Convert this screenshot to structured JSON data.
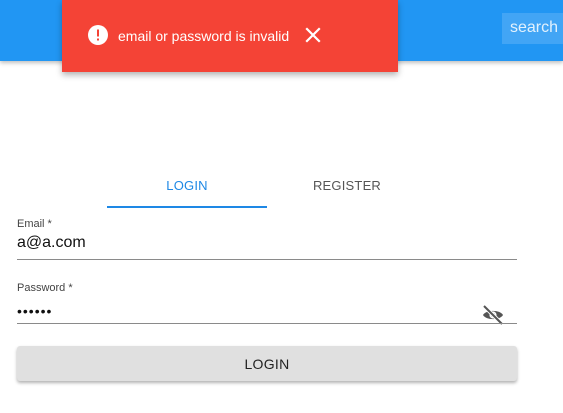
{
  "app_bar": {
    "color": "#2196f3",
    "search": {
      "placeholder": "search"
    }
  },
  "snackbar": {
    "color": "#f44336",
    "icon": "error-icon",
    "message": "email or password is invalid",
    "close_icon": "close-icon"
  },
  "tabs": [
    {
      "label": "LOGIN",
      "active": true
    },
    {
      "label": "REGISTER",
      "active": false
    }
  ],
  "form": {
    "email": {
      "label": "Email *",
      "value": "a@a.com"
    },
    "password": {
      "label": "Password *",
      "value": "••••••",
      "toggle_icon": "visibility-off-icon"
    },
    "submit_label": "LOGIN"
  }
}
